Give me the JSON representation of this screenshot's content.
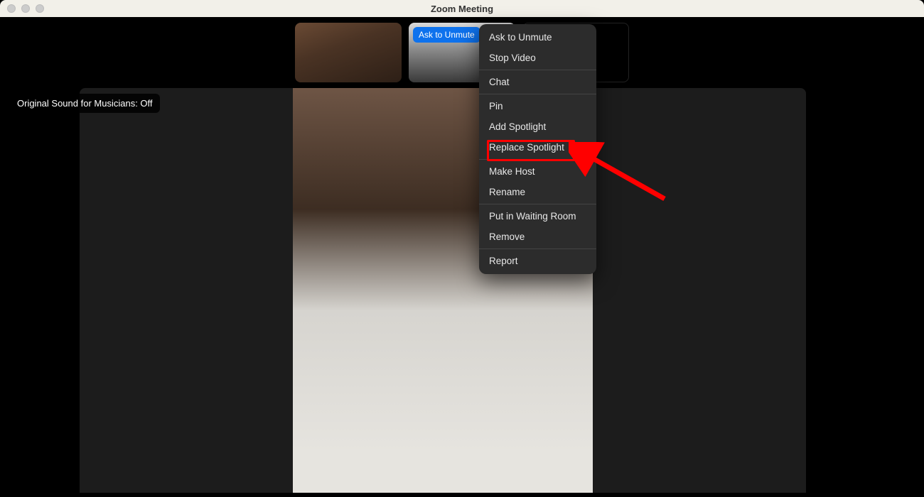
{
  "window": {
    "title": "Zoom Meeting"
  },
  "badges": {
    "original_sound": "Original Sound for Musicians: Off"
  },
  "thumbnail_controls": {
    "ask_unmute": "Ask to Unmute",
    "more_icon": "more-horizontal-icon"
  },
  "context_menu": {
    "groups": [
      [
        "Ask to Unmute",
        "Stop Video"
      ],
      [
        "Chat"
      ],
      [
        "Pin",
        "Add Spotlight",
        "Replace Spotlight"
      ],
      [
        "Make Host",
        "Rename"
      ],
      [
        "Put in Waiting Room",
        "Remove"
      ],
      [
        "Report"
      ]
    ]
  },
  "annotation": {
    "highlighted_item": "Add Spotlight"
  },
  "colors": {
    "accent": "#0e72ed",
    "annotation": "#ff0000"
  }
}
